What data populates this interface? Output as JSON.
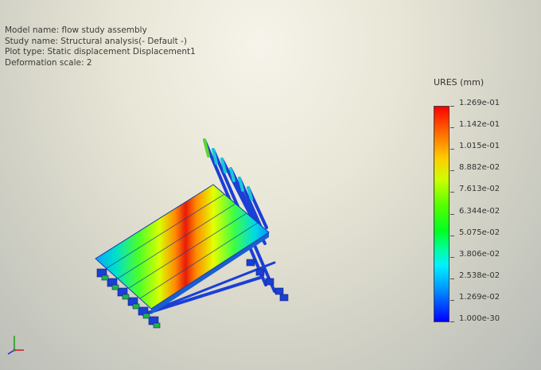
{
  "info": {
    "model_name": "Model name: flow study assembly",
    "study_name": "Study name: Structural analysis(- Default -)",
    "plot_type": "Plot type: Static displacement Displacement1",
    "deformation_scale": "Deformation scale: 2"
  },
  "legend": {
    "title": "URES (mm)",
    "ticks": [
      "1.269e-01",
      "1.142e-01",
      "1.015e-01",
      "8.882e-02",
      "7.613e-02",
      "6.344e-02",
      "5.075e-02",
      "3.806e-02",
      "2.538e-02",
      "1.269e-02",
      "1.000e-30"
    ],
    "max_color": "#ff0000",
    "min_color": "#0000ff"
  },
  "model": {
    "description_icon": "displaced-panel-assembly",
    "panel_count": 5
  },
  "triad": {
    "icon": "axis-triad-icon",
    "x_color": "#d01818",
    "y_color": "#18a018",
    "z_color": "#1830d0"
  }
}
